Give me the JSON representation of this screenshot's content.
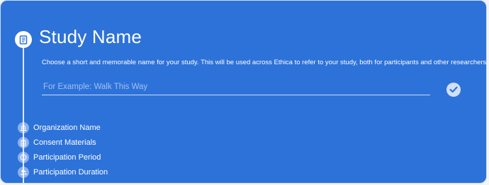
{
  "current_step": {
    "title": "Study Name",
    "icon": "book-icon",
    "description": "Choose a short and memorable name for your study. This will be used across Ethica to refer to your study, both for participants and other researchers.",
    "input": {
      "value": "",
      "placeholder": "For Example: Walk This Way"
    },
    "confirm_icon": "check-circle-icon"
  },
  "steps": [
    {
      "label": "Organization Name",
      "icon": "bank-icon"
    },
    {
      "label": "Consent Materials",
      "icon": "clipboard-icon"
    },
    {
      "label": "Participation Period",
      "icon": "clock-icon"
    },
    {
      "label": "Participation Duration",
      "icon": "users-icon"
    }
  ],
  "colors": {
    "card_background": "#2d72d9",
    "text": "#ffffff"
  }
}
